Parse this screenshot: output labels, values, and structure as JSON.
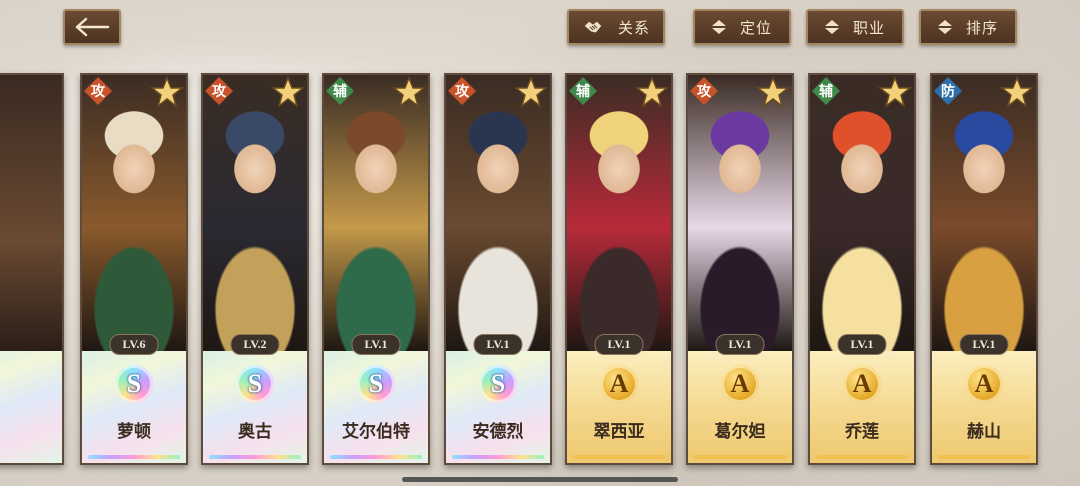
{
  "toolbar": {
    "relation_label": "关系",
    "position_label": "定位",
    "job_label": "职业",
    "sort_label": "排序"
  },
  "colors": {
    "attack": "#c8532a",
    "support": "#3f8a4a",
    "defense": "#2f6fa8",
    "button_bg": "#5a3d29",
    "button_border": "#a58660"
  },
  "cards": [
    {
      "role": "攻",
      "role_type": "attack",
      "level": "LV.6",
      "grade": "S",
      "name": "萝顿",
      "palette": [
        "#e8dcc4",
        "#2f5a3a",
        "#8a5a2c"
      ]
    },
    {
      "role": "攻",
      "role_type": "attack",
      "level": "LV.2",
      "grade": "S",
      "name": "奥古",
      "palette": [
        "#3a4a66",
        "#c4a15a",
        "#2a2a32"
      ]
    },
    {
      "role": "辅",
      "role_type": "support",
      "level": "LV.1",
      "grade": "S",
      "name": "艾尔伯特",
      "palette": [
        "#7a4a2a",
        "#2f6a4a",
        "#c49a4a"
      ]
    },
    {
      "role": "攻",
      "role_type": "attack",
      "level": "LV.1",
      "grade": "S",
      "name": "安德烈",
      "palette": [
        "#2a3550",
        "#e8e4dc",
        "#6a4a30"
      ]
    },
    {
      "role": "辅",
      "role_type": "support",
      "level": "LV.1",
      "grade": "A",
      "name": "翠西亚",
      "palette": [
        "#f0d27a",
        "#3a2a2a",
        "#b82a3a"
      ]
    },
    {
      "role": "攻",
      "role_type": "attack",
      "level": "LV.1",
      "grade": "A",
      "name": "葛尔妲",
      "palette": [
        "#6a3aa0",
        "#2a1a2a",
        "#e8d8e8"
      ]
    },
    {
      "role": "辅",
      "role_type": "support",
      "level": "LV.1",
      "grade": "A",
      "name": "乔莲",
      "palette": [
        "#e0502a",
        "#f5e0a0",
        "#3a2a2a"
      ]
    },
    {
      "role": "防",
      "role_type": "defense",
      "level": "LV.1",
      "grade": "A",
      "name": "赫山",
      "palette": [
        "#2a4aa0",
        "#d8a040",
        "#7a4a2a"
      ]
    }
  ]
}
